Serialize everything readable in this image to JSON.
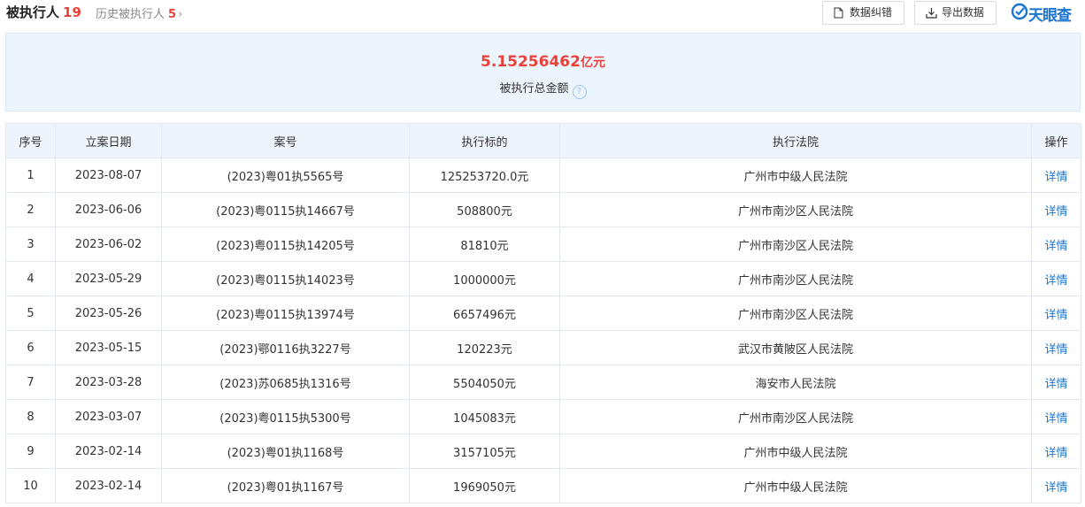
{
  "tabs": {
    "main": {
      "label": "被执行人",
      "count": "19"
    },
    "history": {
      "label": "历史被执行人",
      "count": "5",
      "chevron": "›"
    }
  },
  "toolbar": {
    "correction_label": "数据纠错",
    "export_label": "导出数据",
    "logo_text": "天眼查"
  },
  "summary": {
    "amount": "5.15256462",
    "unit": "亿元",
    "label": "被执行总金额",
    "help": "?"
  },
  "table": {
    "headers": {
      "index": "序号",
      "date": "立案日期",
      "case_no": "案号",
      "target": "执行标的",
      "court": "执行法院",
      "action": "操作"
    },
    "rows": [
      {
        "index": "1",
        "date": "2023-08-07",
        "case_no": "(2023)粤01执5565号",
        "target": "125253720.0元",
        "court": "广州市中级人民法院",
        "action": "详情"
      },
      {
        "index": "2",
        "date": "2023-06-06",
        "case_no": "(2023)粤0115执14667号",
        "target": "508800元",
        "court": "广州市南沙区人民法院",
        "action": "详情"
      },
      {
        "index": "3",
        "date": "2023-06-02",
        "case_no": "(2023)粤0115执14205号",
        "target": "81810元",
        "court": "广州市南沙区人民法院",
        "action": "详情"
      },
      {
        "index": "4",
        "date": "2023-05-29",
        "case_no": "(2023)粤0115执14023号",
        "target": "1000000元",
        "court": "广州市南沙区人民法院",
        "action": "详情"
      },
      {
        "index": "5",
        "date": "2023-05-26",
        "case_no": "(2023)粤0115执13974号",
        "target": "6657496元",
        "court": "广州市南沙区人民法院",
        "action": "详情"
      },
      {
        "index": "6",
        "date": "2023-05-15",
        "case_no": "(2023)鄂0116执3227号",
        "target": "120223元",
        "court": "武汉市黄陂区人民法院",
        "action": "详情"
      },
      {
        "index": "7",
        "date": "2023-03-28",
        "case_no": "(2023)苏0685执1316号",
        "target": "5504050元",
        "court": "海安市人民法院",
        "action": "详情"
      },
      {
        "index": "8",
        "date": "2023-03-07",
        "case_no": "(2023)粤0115执5300号",
        "target": "1045083元",
        "court": "广州市南沙区人民法院",
        "action": "详情"
      },
      {
        "index": "9",
        "date": "2023-02-14",
        "case_no": "(2023)粤01执1168号",
        "target": "3157105元",
        "court": "广州市中级人民法院",
        "action": "详情"
      },
      {
        "index": "10",
        "date": "2023-02-14",
        "case_no": "(2023)粤01执1167号",
        "target": "1969050元",
        "court": "广州市中级人民法院",
        "action": "详情"
      }
    ]
  },
  "colors": {
    "accent": "#1a76d2",
    "highlight": "#e9423b",
    "summary_bg": "#ecf4fe",
    "header_bg": "#eef4fc"
  }
}
